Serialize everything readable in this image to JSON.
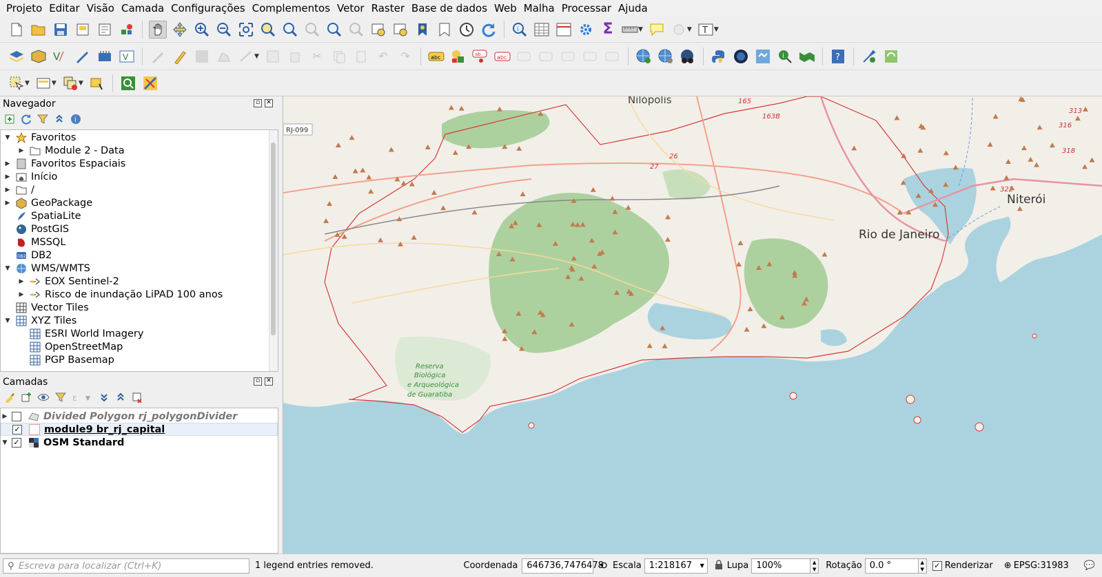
{
  "menu": [
    "Projeto",
    "Editar",
    "Visão",
    "Camada",
    "Configurações",
    "Complementos",
    "Vetor",
    "Raster",
    "Base de dados",
    "Web",
    "Malha",
    "Processar",
    "Ajuda"
  ],
  "navigator": {
    "title": "Navegador",
    "items": [
      {
        "label": "Favoritos",
        "level": 0,
        "arrow": "down",
        "icon": "star-icon"
      },
      {
        "label": "Module 2 - Data",
        "level": 1,
        "arrow": "right",
        "icon": "folder-icon"
      },
      {
        "label": "Favoritos Espaciais",
        "level": 0,
        "arrow": "right",
        "icon": "spatial-bookmark-icon"
      },
      {
        "label": "Início",
        "level": 0,
        "arrow": "right",
        "icon": "home-folder-icon"
      },
      {
        "label": "/",
        "level": 0,
        "arrow": "right",
        "icon": "folder-icon"
      },
      {
        "label": "GeoPackage",
        "level": 0,
        "arrow": "right",
        "icon": "geopackage-icon"
      },
      {
        "label": "SpatiaLite",
        "level": 0,
        "arrow": "none",
        "icon": "spatialite-icon"
      },
      {
        "label": "PostGIS",
        "level": 0,
        "arrow": "none",
        "icon": "postgis-icon"
      },
      {
        "label": "MSSQL",
        "level": 0,
        "arrow": "none",
        "icon": "mssql-icon"
      },
      {
        "label": "DB2",
        "level": 0,
        "arrow": "none",
        "icon": "db2-icon"
      },
      {
        "label": "WMS/WMTS",
        "level": 0,
        "arrow": "down",
        "icon": "globe-icon"
      },
      {
        "label": "EOX Sentinel-2",
        "level": 1,
        "arrow": "right",
        "icon": "wms-layer-icon"
      },
      {
        "label": "Risco de inundação LiPAD 100 anos",
        "level": 1,
        "arrow": "right",
        "icon": "wms-layer-icon"
      },
      {
        "label": "Vector Tiles",
        "level": 0,
        "arrow": "none",
        "icon": "vector-tiles-icon"
      },
      {
        "label": "XYZ Tiles",
        "level": 0,
        "arrow": "down",
        "icon": "xyz-tiles-icon"
      },
      {
        "label": "ESRI World Imagery",
        "level": 1,
        "arrow": "none",
        "icon": "tile-grid-icon"
      },
      {
        "label": "OpenStreetMap",
        "level": 1,
        "arrow": "none",
        "icon": "tile-grid-icon"
      },
      {
        "label": "PGP Basemap",
        "level": 1,
        "arrow": "none",
        "icon": "tile-grid-icon"
      }
    ]
  },
  "layers": {
    "title": "Camadas",
    "items": [
      {
        "label": "Divided Polygon rj_polygonDivider",
        "checked": false,
        "style": "italic-grey"
      },
      {
        "label": "module9 br_rj_capital",
        "checked": true,
        "style": "bold-underline"
      },
      {
        "label": "OSM Standard",
        "checked": true,
        "style": "bold"
      }
    ]
  },
  "map_labels": {
    "nilopolis": "Nilópolis",
    "rj099": "RJ-099",
    "rio": "Rio de Janeiro",
    "niteroi": "Niterói",
    "reserva1": "Reserva",
    "reserva2": "Biológica",
    "reserva3": "e Arqueológica",
    "reserva4": "de Guaratiba",
    "r165": "165",
    "r163b": "163B",
    "r313": "313",
    "r316": "316",
    "r318": "318",
    "r322": "322",
    "r27": "27",
    "r26": "26"
  },
  "status": {
    "locator_placeholder": "Escreva para localizar (Ctrl+K)",
    "message": "1 legend entries removed.",
    "coord_label": "Coordenada",
    "coord_value": "646736,7476478",
    "scale_label": "Escala",
    "scale_value": "1:218167",
    "magnifier_label": "Lupa",
    "magnifier_value": "100%",
    "rotation_label": "Rotação",
    "rotation_value": "0.0 °",
    "render_label": "Renderizar",
    "render_checked": true,
    "crs": "EPSG:31983"
  },
  "colors": {
    "water": "#aad3df",
    "land": "#f2efe9",
    "forest": "#add19e",
    "road_primary": "#f4a08b",
    "road_motorway": "#e892a2",
    "road_secondary": "#f7d99b",
    "boundary": "#d83a3a"
  }
}
